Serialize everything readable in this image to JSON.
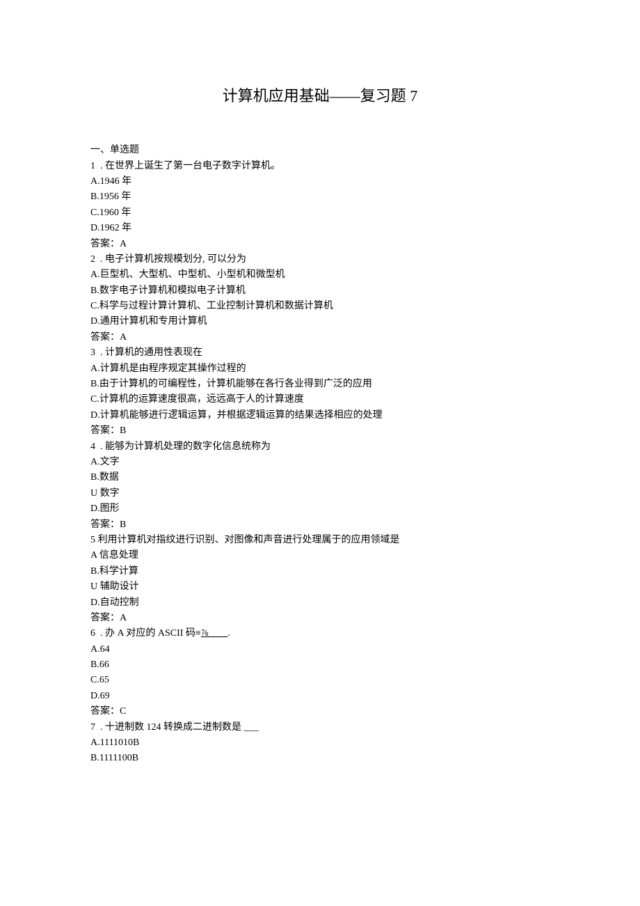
{
  "title": "计算机应用基础——复习题 7",
  "section_header": "一、单选题",
  "questions": [
    {
      "num": "1",
      "stem_prefix": "  . 在世界上诞生了第一台电子数字计算机。",
      "options": [
        "A.1946 年",
        "B.1956 年",
        "C.1960 年",
        "D.1962 年"
      ],
      "answer": "答案：A"
    },
    {
      "num": "2",
      "stem_prefix": "  . 电子计算机按规模划分, 可以分为",
      "options": [
        "A.巨型机、大型机、中型机、小型机和微型机",
        "B.数字电子计算机和模拟电子计算机",
        "C.科学与过程计算计算机、工业控制计算机和数据计算机",
        "D.通用计算机和专用计算机"
      ],
      "answer": "答案：A"
    },
    {
      "num": "3",
      "stem_prefix": "  . 计算机的通用性表现在",
      "options": [
        "A.计算机是由程序规定其操作过程的",
        "B.由于计算机的可编程性，计算机能够在各行各业得到广泛的应用",
        "C.计算机的运算速度很高，远远高于人的计算速度",
        "D.计算机能够进行逻辑运算，并根据逻辑运算的结果选择相应的处理"
      ],
      "answer": "答案：B"
    },
    {
      "num": "4",
      "stem_prefix": "  . 能够为计算机处理的数字化信息统称为",
      "options": [
        "A.文字",
        "B.数据",
        "U 数字",
        "D.图形"
      ],
      "answer": "答案：B"
    },
    {
      "num": "5",
      "stem_prefix": " 利用计算机对指纹进行识别、对图像和声音进行处理属于的应用领域是",
      "options": [
        "A 信息处理",
        "B.科学计算",
        "U 辅助设计",
        "D.自动控制"
      ],
      "answer": "答案：A"
    },
    {
      "num": "6",
      "stem_before": "  . 办 A 对应的 ASCII 码≡",
      "stem_underline": "⅞____",
      "stem_after": ".",
      "options": [
        "A.64",
        "B.66",
        "C.65",
        "D.69"
      ],
      "answer": "答案：C"
    },
    {
      "num": "7",
      "stem_prefix": "  . 十进制数 124 转换成二进制数是 ___",
      "options": [
        "A.1111010B",
        "B.1111100B"
      ],
      "answer": ""
    }
  ]
}
